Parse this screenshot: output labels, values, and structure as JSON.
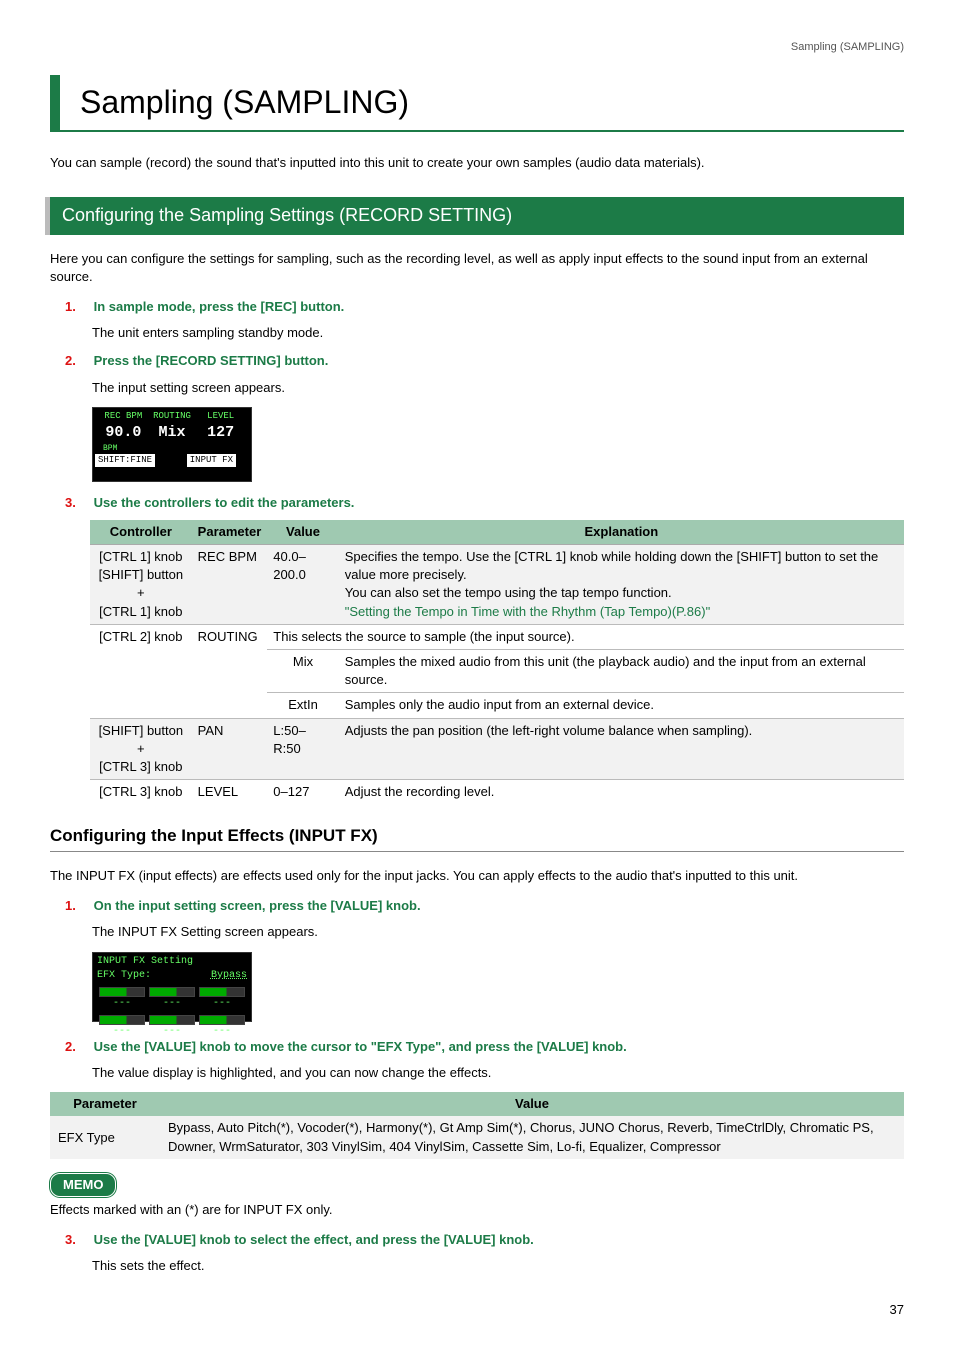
{
  "header_right": "Sampling (SAMPLING)",
  "chapter_title": "Sampling (SAMPLING)",
  "intro": "You can sample (record) the sound that's inputted into this unit to create your own samples (audio data materials).",
  "section1_title": "Configuring the Sampling Settings (RECORD SETTING)",
  "section1_intro": "Here you can configure the settings for sampling, such as the recording level, as well as apply input effects to the sound input from an external source.",
  "step1_num": "1.",
  "step1_text": "In sample mode, press the [REC] button.",
  "step1_sub": "The unit enters sampling standby mode.",
  "step2_num": "2.",
  "step2_text": "Press the [RECORD SETTING] button.",
  "step2_sub": "The input setting screen appears.",
  "lcd1": {
    "h1": "REC BPM",
    "h2": "ROUTING",
    "h3": "LEVEL",
    "v1": "90.0",
    "v2": "Mix",
    "v3": "127",
    "bpm": "BPM",
    "shift": "SHIFT:FINE",
    "inputfx": "INPUT FX"
  },
  "step3_num": "3.",
  "step3_text": "Use the controllers to edit the parameters.",
  "table1": {
    "h_controller": "Controller",
    "h_parameter": "Parameter",
    "h_value": "Value",
    "h_explanation": "Explanation",
    "r1_controller_a": "[CTRL 1] knob",
    "r1_controller_b": "[SHIFT] button +",
    "r1_controller_c": "[CTRL 1] knob",
    "r1_parameter": "REC BPM",
    "r1_value": "40.0–200.0",
    "r1_exp_a": "Specifies the tempo. Use the [CTRL 1] knob while holding down the [SHIFT] button to set the value more precisely.",
    "r1_exp_b": "You can also set the tempo using the tap tempo function.",
    "r1_link": "\"Setting the Tempo in Time with the Rhythm (Tap Tempo)(P.86)\"",
    "r2_controller": "[CTRL 2] knob",
    "r2_parameter": "ROUTING",
    "r2_exp_main": "This selects the source to sample (the input source).",
    "r2_val_mix": "Mix",
    "r2_exp_mix": "Samples the mixed audio from this unit (the playback audio) and the input from an external source.",
    "r2_val_ext": "ExtIn",
    "r2_exp_ext": "Samples only the audio input from an external device.",
    "r3_controller_a": "[SHIFT] button +",
    "r3_controller_b": "[CTRL 3] knob",
    "r3_parameter": "PAN",
    "r3_value": "L:50–R:50",
    "r3_exp": "Adjusts the pan position (the left-right volume balance when sampling).",
    "r4_controller": "[CTRL 3] knob",
    "r4_parameter": "LEVEL",
    "r4_value": "0–127",
    "r4_exp": "Adjust the recording level."
  },
  "section2_title": "Configuring the Input Effects (INPUT FX)",
  "section2_intro": "The INPUT FX (input effects) are effects used only for the input jacks. You can apply effects to the audio that's inputted to this unit.",
  "s2_step1_num": "1.",
  "s2_step1_text": "On the input setting screen, press the [VALUE] knob.",
  "s2_step1_sub": "The INPUT FX Setting screen appears.",
  "lcd2": {
    "title": "INPUT FX Setting",
    "type": "EFX Type:",
    "bypass": "Bypass",
    "dash": "---"
  },
  "s2_step2_num": "2.",
  "s2_step2_text": "Use the [VALUE] knob to move the cursor to \"EFX Type\", and press the [VALUE] knob.",
  "s2_step2_sub": "The value display is highlighted, and you can now change the effects.",
  "table2": {
    "h_parameter": "Parameter",
    "h_value": "Value",
    "r_param": "EFX Type",
    "r_value": "Bypass, Auto Pitch(*), Vocoder(*), Harmony(*), Gt Amp Sim(*), Chorus, JUNO Chorus, Reverb, TimeCtrlDly, Chromatic PS, Downer, WrmSaturator, 303 VinylSim, 404 VinylSim, Cassette Sim, Lo-fi, Equalizer, Compressor"
  },
  "memo_label": "MEMO",
  "memo_text": "Effects marked with an (*) are for INPUT FX only.",
  "s2_step3_num": "3.",
  "s2_step3_text": "Use the [VALUE] knob to select the effect, and press the [VALUE] knob.",
  "s2_step3_sub": "This sets the effect.",
  "page_num": "37"
}
